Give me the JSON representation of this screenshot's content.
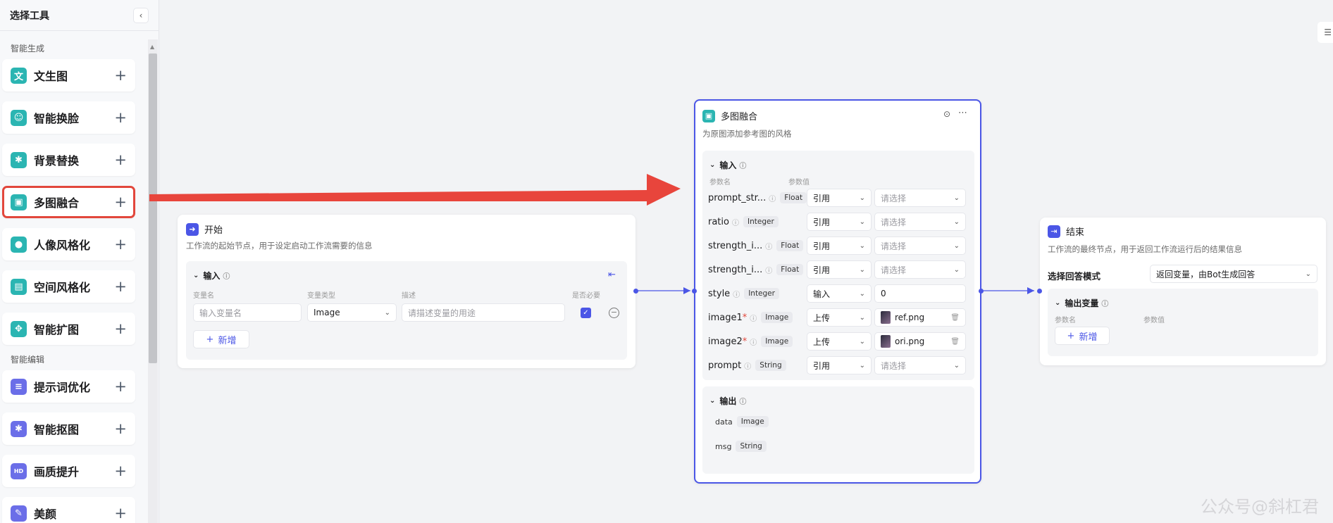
{
  "sidebar": {
    "title": "选择工具",
    "sections": [
      {
        "label": "智能生成"
      },
      {
        "label": "智能编辑"
      }
    ],
    "tools": [
      {
        "label": "文生图",
        "glyph": "文",
        "color": "#2bb5b2"
      },
      {
        "label": "智能换脸",
        "glyph": "☺",
        "color": "#2bb5b2"
      },
      {
        "label": "背景替换",
        "glyph": "✱",
        "color": "#2bb5b2"
      },
      {
        "label": "多图融合",
        "glyph": "▣",
        "color": "#2bb5b2"
      },
      {
        "label": "人像风格化",
        "glyph": "●",
        "color": "#2bb5b2"
      },
      {
        "label": "空间风格化",
        "glyph": "▤",
        "color": "#2bb5b2"
      },
      {
        "label": "智能扩图",
        "glyph": "✥",
        "color": "#2bb5b2"
      },
      {
        "label": "提示词优化",
        "glyph": "≡",
        "color": "#6b6ee8"
      },
      {
        "label": "智能抠图",
        "glyph": "✱",
        "color": "#6b6ee8"
      },
      {
        "label": "画质提升",
        "glyph": "HD",
        "color": "#6b6ee8"
      },
      {
        "label": "美颜",
        "glyph": "✎",
        "color": "#6b6ee8"
      }
    ]
  },
  "start_node": {
    "title": "开始",
    "desc": "工作流的起始节点，用于设定启动工作流需要的信息",
    "input_label": "输入",
    "col_name": "变量名",
    "col_type": "变量类型",
    "col_desc": "描述",
    "col_required": "是否必要",
    "name_placeholder": "输入变量名",
    "type_value": "Image",
    "desc_placeholder": "请描述变量的用途",
    "add_label": "新增"
  },
  "fusion_node": {
    "title": "多图融合",
    "desc": "为原图添加参考图的风格",
    "input_label": "输入",
    "col_name": "参数名",
    "col_value": "参数值",
    "params": [
      {
        "name": "prompt_str...",
        "required": false,
        "type": "Float",
        "mode": "引用",
        "value": "请选择",
        "kind": "select"
      },
      {
        "name": "ratio",
        "required": false,
        "type": "Integer",
        "mode": "引用",
        "value": "请选择",
        "kind": "select"
      },
      {
        "name": "strength_i...",
        "required": false,
        "type": "Float",
        "mode": "引用",
        "value": "请选择",
        "kind": "select"
      },
      {
        "name": "strength_i...",
        "required": false,
        "type": "Float",
        "mode": "引用",
        "value": "请选择",
        "kind": "select"
      },
      {
        "name": "style",
        "required": false,
        "type": "Integer",
        "mode": "输入",
        "value": "0",
        "kind": "text"
      },
      {
        "name": "image1",
        "required": true,
        "type": "Image",
        "mode": "上传",
        "value": "ref.png",
        "kind": "file"
      },
      {
        "name": "image2",
        "required": true,
        "type": "Image",
        "mode": "上传",
        "value": "ori.png",
        "kind": "file"
      },
      {
        "name": "prompt",
        "required": false,
        "type": "String",
        "mode": "引用",
        "value": "请选择",
        "kind": "select"
      }
    ],
    "output_label": "输出",
    "outputs": [
      {
        "name": "data",
        "type": "Image"
      },
      {
        "name": "msg",
        "type": "String"
      }
    ]
  },
  "end_node": {
    "title": "结束",
    "desc": "工作流的最终节点，用于返回工作流运行后的结果信息",
    "mode_label": "选择回答模式",
    "mode_value": "返回变量，由Bot生成回答",
    "output_var_label": "输出变量",
    "col_name": "参数名",
    "col_value": "参数值",
    "add_label": "新增"
  },
  "watermark": "公众号@斜杠君",
  "colors": {
    "accent": "#4b56e6",
    "highlight": "#e2473c"
  }
}
